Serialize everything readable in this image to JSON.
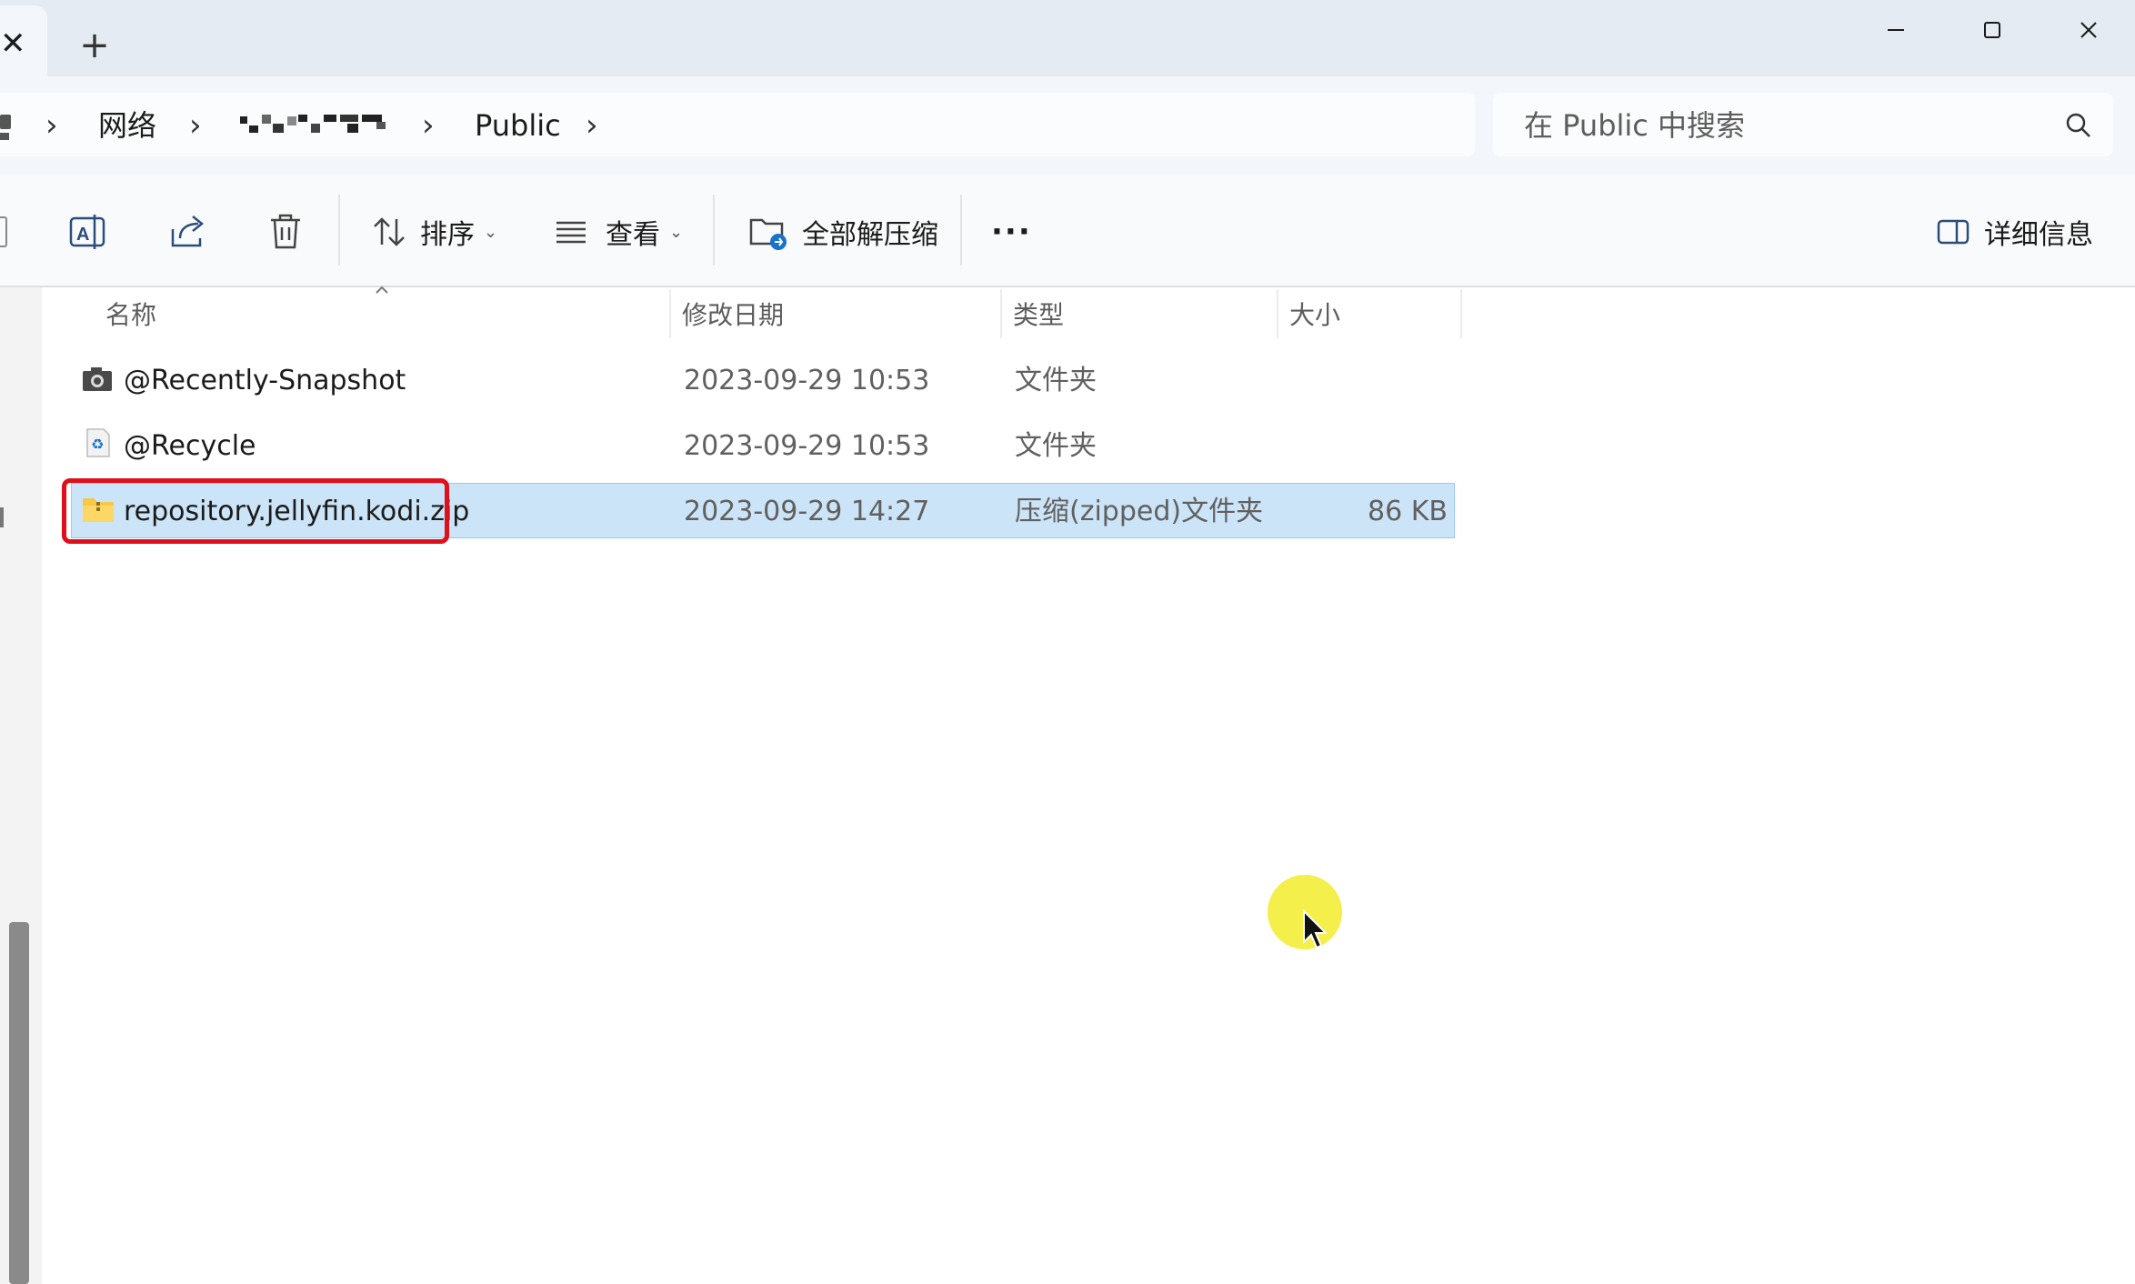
{
  "window": {
    "tab_close_glyph": "✕",
    "new_tab_glyph": "+",
    "icons": [
      "minimize-icon",
      "maximize-icon",
      "close-icon"
    ]
  },
  "address": {
    "breadcrumbs": [
      "网络",
      "Public"
    ],
    "redacted_segment": "[mosaic]",
    "separator": "›"
  },
  "search": {
    "placeholder": "在 Public 中搜索",
    "icon": "search-icon"
  },
  "toolbar": {
    "sort_label": "排序",
    "view_label": "查看",
    "extract_label": "全部解压缩",
    "more_label": "···",
    "details_label": "详细信息",
    "icons": [
      "rename-icon",
      "share-icon",
      "delete-icon",
      "sort-icon",
      "view-icon",
      "extract-icon",
      "details-pane-icon"
    ]
  },
  "columns": {
    "name": "名称",
    "date": "修改日期",
    "type": "类型",
    "size": "大小"
  },
  "files": [
    {
      "name": "@Recently-Snapshot",
      "date": "2023-09-29 10:53",
      "type": "文件夹",
      "size": "",
      "icon": "camera-folder-icon"
    },
    {
      "name": "@Recycle",
      "date": "2023-09-29 10:53",
      "type": "文件夹",
      "size": "",
      "icon": "recycle-folder-icon"
    },
    {
      "name": "repository.jellyfin.kodi.zip",
      "date": "2023-09-29 14:27",
      "type": "压缩(zipped)文件夹",
      "size": "86 KB",
      "icon": "zip-folder-icon",
      "selected": true
    }
  ],
  "colors": {
    "selection": "#cce4f7",
    "highlight": "#e00f1c",
    "cursor_glow": "#f3ee3b",
    "titlebar": "#e5ebf3"
  }
}
